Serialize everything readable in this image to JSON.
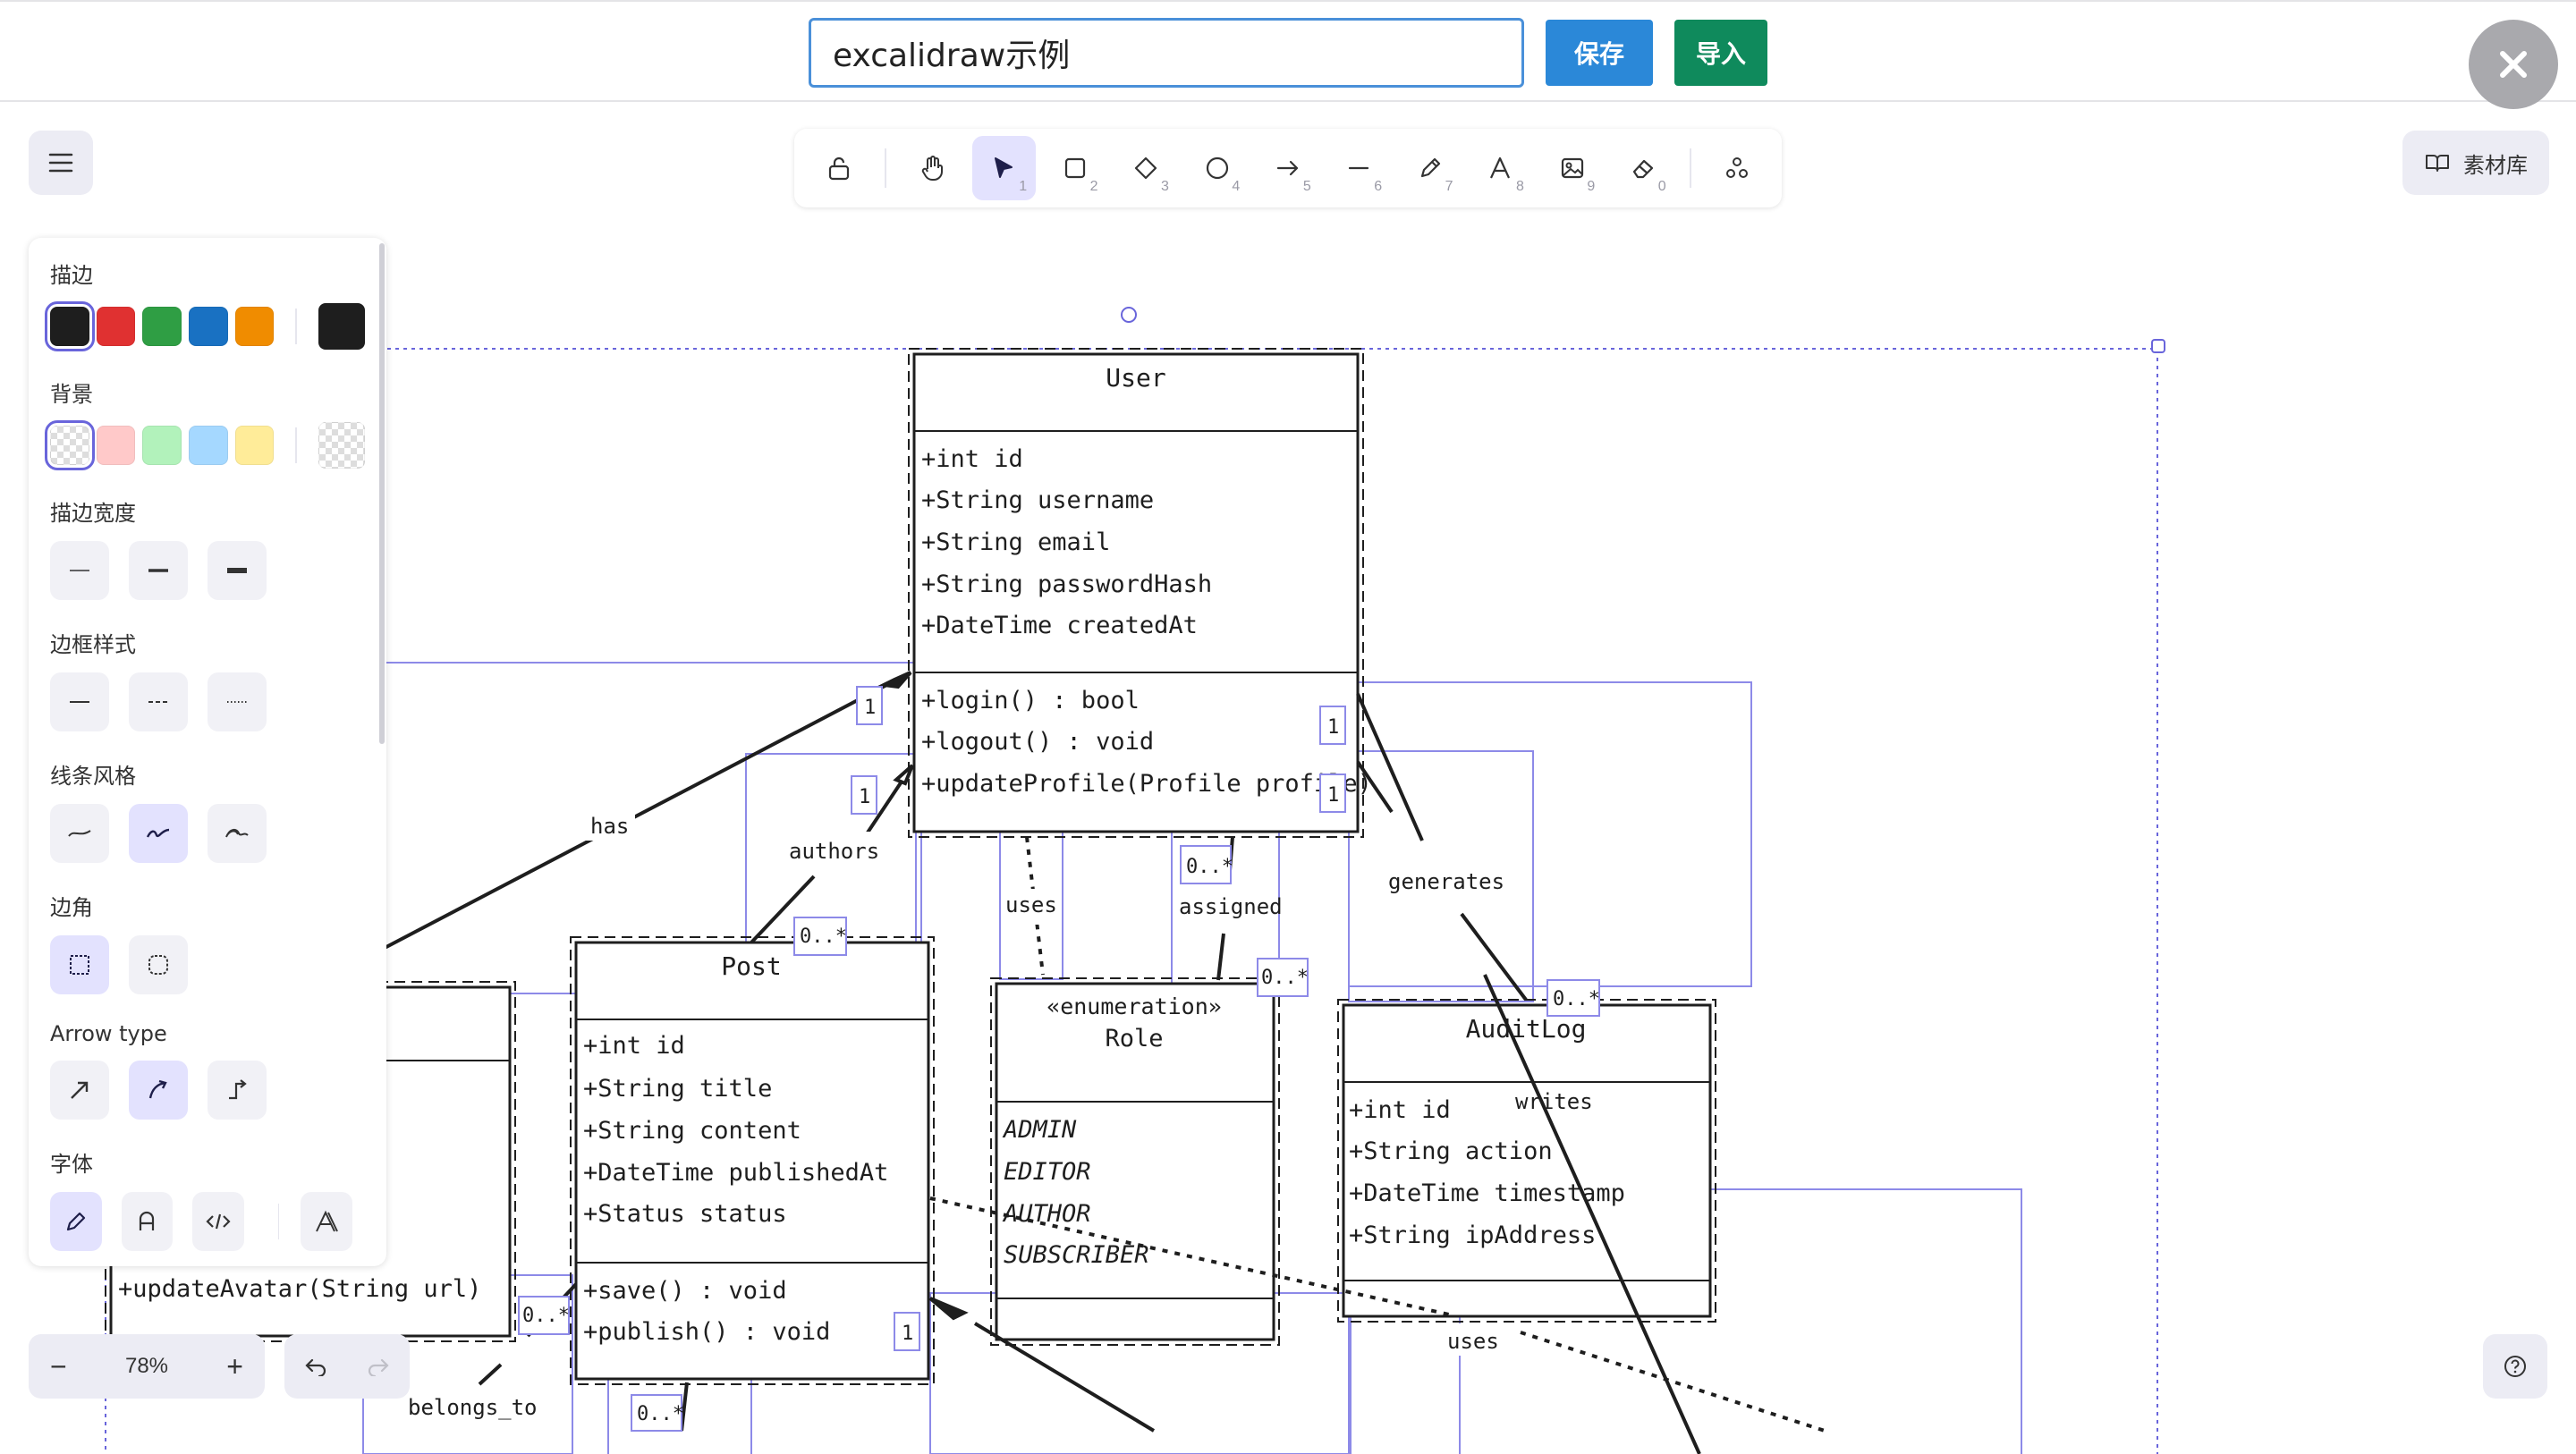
{
  "header": {
    "title_value": "excalidraw示例",
    "save_label": "保存",
    "import_label": "导入",
    "close_icon": "close-icon"
  },
  "toolbar": {
    "tools": [
      {
        "name": "lock",
        "icon": "lock-icon",
        "num": ""
      },
      {
        "name": "hand",
        "icon": "hand-icon",
        "num": ""
      },
      {
        "name": "selection",
        "icon": "cursor-icon",
        "num": "1",
        "active": true
      },
      {
        "name": "rectangle",
        "icon": "rectangle-icon",
        "num": "2"
      },
      {
        "name": "diamond",
        "icon": "diamond-icon",
        "num": "3"
      },
      {
        "name": "ellipse",
        "icon": "ellipse-icon",
        "num": "4"
      },
      {
        "name": "arrow",
        "icon": "arrow-icon",
        "num": "5"
      },
      {
        "name": "line",
        "icon": "line-icon",
        "num": "6"
      },
      {
        "name": "draw",
        "icon": "pencil-icon",
        "num": "7"
      },
      {
        "name": "text",
        "icon": "text-icon",
        "num": "8"
      },
      {
        "name": "image",
        "icon": "image-icon",
        "num": "9"
      },
      {
        "name": "eraser",
        "icon": "eraser-icon",
        "num": "0"
      },
      {
        "name": "extra",
        "icon": "shapes-icon",
        "num": ""
      }
    ]
  },
  "library": {
    "label": "素材库"
  },
  "props": {
    "stroke_label": "描边",
    "stroke_colors": [
      "#1e1e1e",
      "#e03131",
      "#2f9e44",
      "#1971c2",
      "#f08c00"
    ],
    "stroke_current": "#1e1e1e",
    "background_label": "背景",
    "background_colors": [
      "transparent",
      "#ffc9c9",
      "#b2f2bb",
      "#a5d8ff",
      "#ffec99"
    ],
    "stroke_width_label": "描边宽度",
    "stroke_style_label": "边框样式",
    "sloppiness_label": "线条风格",
    "edges_label": "边角",
    "arrow_type_label": "Arrow type",
    "font_label": "字体"
  },
  "zoom": {
    "value": "78%",
    "minus": "−",
    "plus": "+"
  },
  "diagram": {
    "user": {
      "title": "User",
      "attrs": [
        "+int id",
        "+String username",
        "+String email",
        "+String passwordHash",
        "+DateTime createdAt"
      ],
      "methods": [
        "+login() : bool",
        "+logout() : void",
        "+updateProfile(Profile profile)"
      ]
    },
    "post": {
      "title": "Post",
      "attrs": [
        "+int id",
        "+String title",
        "+String content",
        "+DateTime publishedAt",
        "+Status status"
      ],
      "methods": [
        "+save() : void",
        "+publish() : void"
      ]
    },
    "role": {
      "stereotype": "«enumeration»",
      "title": "Role",
      "values": [
        "ADMIN",
        "EDITOR",
        "AUTHOR",
        "SUBSCRIBER"
      ]
    },
    "auditlog": {
      "title": "AuditLog",
      "attrs": [
        "+int id",
        "+String action",
        "+DateTime timestamp",
        "+String ipAddress"
      ]
    },
    "profile_partial": {
      "method": "+updateAvatar(String url)"
    },
    "labels": {
      "has": "has",
      "authors": "authors",
      "uses": "uses",
      "assigned": "assigned",
      "generates": "generates",
      "writes": "writes",
      "uses2": "uses",
      "belongs_to": "belongs_to"
    },
    "multiplicities": {
      "m1": "1",
      "m2": "1",
      "m3": "1",
      "m4": "1",
      "m5": "1",
      "m6": "0..*",
      "m7": "0..*",
      "m8": "0..*",
      "m9": "0..*",
      "m10": "0..*",
      "m11": "0..*"
    }
  }
}
